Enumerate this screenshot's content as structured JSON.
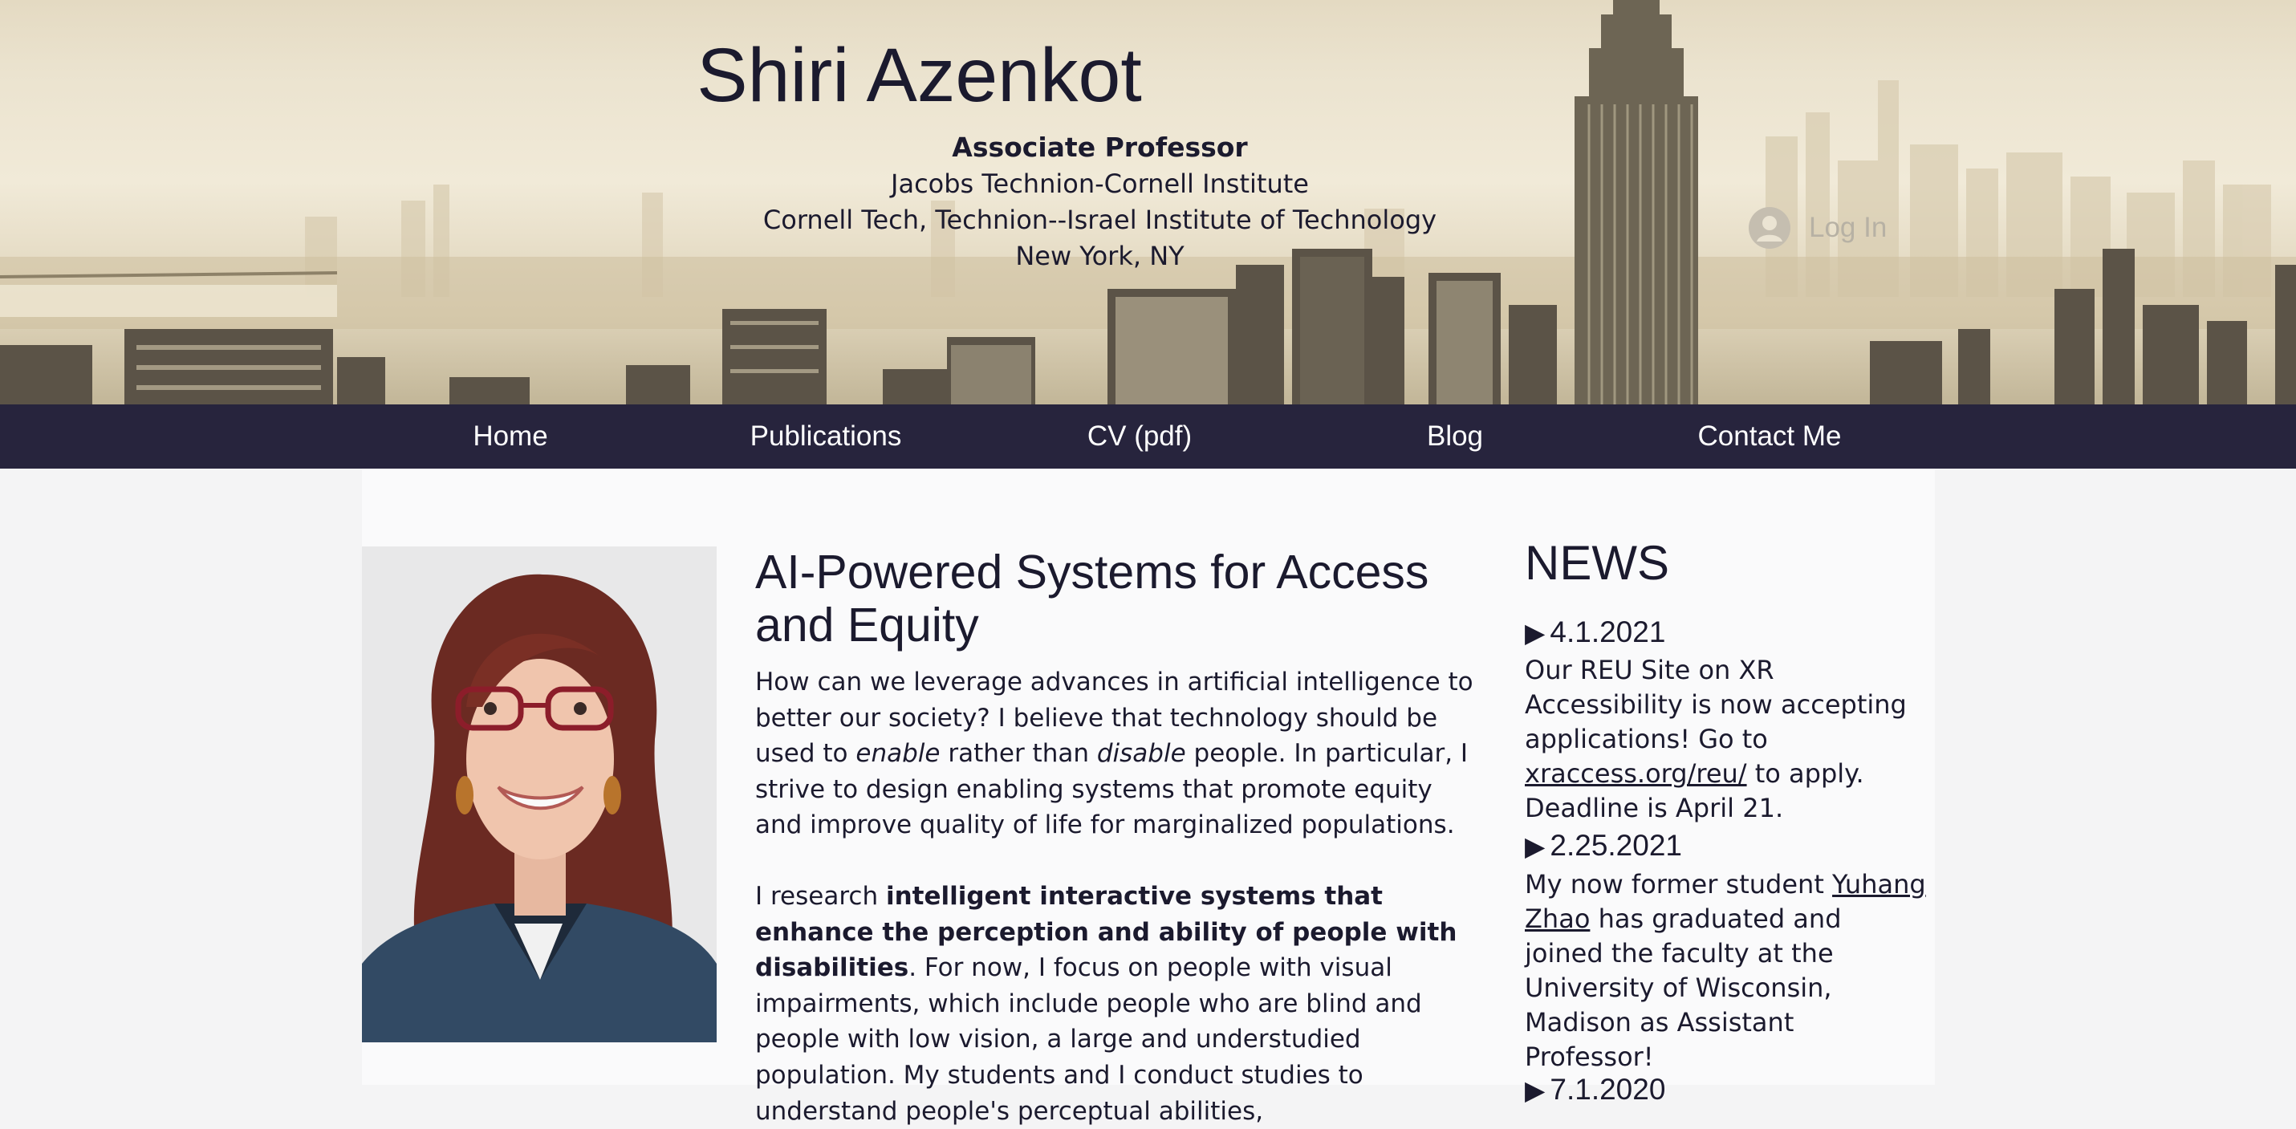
{
  "header": {
    "name": "Shiri Azenkot",
    "role": "Associate Professor",
    "institution_line1": "Jacobs Technion-Cornell Institute",
    "institution_line2": "Cornell Tech, Technion--Israel Institute of Technology",
    "location": "New York, NY",
    "login_label": "Log In"
  },
  "nav": {
    "items": [
      "Home",
      "Publications",
      "CV (pdf)",
      "Blog",
      "Contact Me"
    ]
  },
  "main": {
    "title": "AI-Powered Systems for Access and Equity",
    "p1": {
      "a": "How can we leverage advances in artificial intelligence to better our society? I believe that technology should be used to ",
      "em1": "enable",
      "b": " rather than ",
      "em2": "disable",
      "c": " people. In particular, I strive to design enabling systems that promote equity and improve quality of life for marginalized populations."
    },
    "p2": {
      "a": "I research ",
      "strong": "intelligent interactive systems that enhance the perception and ability of people with disabilities",
      "b": ". For now, I focus on people with visual impairments, which include people who are blind and people with low vision, a large and understudied population. My students and I conduct studies to understand people's perceptual abilities,"
    }
  },
  "news": {
    "title": "NEWS",
    "items": [
      {
        "date": "4.1.2021",
        "text_a": "Our REU Site on XR Accessibility is now accepting applications! Go to ",
        "link": "xraccess.org/reu/",
        "text_b": " to apply. Deadline is April 21."
      },
      {
        "date": "2.25.2021",
        "text_a": "My now former student ",
        "link": "Yuhang Zhao",
        "text_b": " has graduated and joined the faculty at the University of Wisconsin, Madison as Assistant Professor!"
      },
      {
        "date": "7.1.2020"
      }
    ]
  },
  "colors": {
    "nav_background": "#27243d",
    "text": "#1b1a2e",
    "content_background": "#fafafb"
  }
}
